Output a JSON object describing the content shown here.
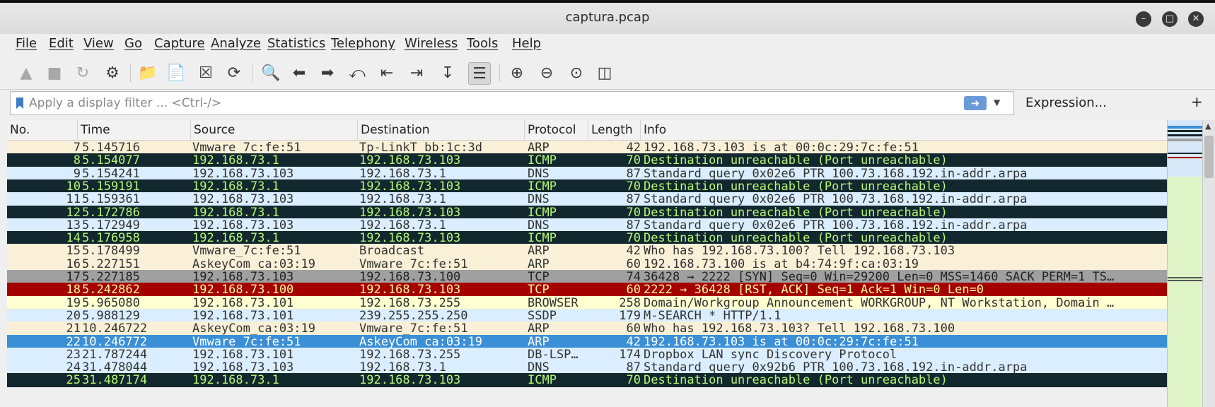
{
  "window": {
    "title": "captura.pcap"
  },
  "menu": [
    "File",
    "Edit",
    "View",
    "Go",
    "Capture",
    "Analyze",
    "Statistics",
    "Telephony",
    "Wireless",
    "Tools",
    "Help"
  ],
  "filter": {
    "placeholder": "Apply a display filter ... <Ctrl-/>",
    "expression_label": "Expression...",
    "add_label": "+"
  },
  "columns": [
    "No.",
    "Time",
    "Source",
    "Destination",
    "Protocol",
    "Length",
    "Info"
  ],
  "colors": {
    "arp_bg": "#faf0d7",
    "icmp_bg": "#12272e",
    "icmp_fg": "#b7f774",
    "dns_bg": "#daeeff",
    "tcp_syn_bg": "#a0a0a0",
    "tcp_rst_bg": "#a40000",
    "tcp_rst_fg": "#fffc9c",
    "browser_bg": "#fefed0",
    "selected_bg": "#3b8fd6"
  },
  "packets": [
    {
      "no": "7",
      "time": "5.145716",
      "src": "Vmware_7c:fe:51",
      "dst": "Tp-LinkT_bb:1c:3d",
      "proto": "ARP",
      "len": "42",
      "info": "192.168.73.103 is at 00:0c:29:7c:fe:51",
      "style": "arp"
    },
    {
      "no": "8",
      "time": "5.154077",
      "src": "192.168.73.1",
      "dst": "192.168.73.103",
      "proto": "ICMP",
      "len": "70",
      "info": "Destination unreachable (Port unreachable)",
      "style": "icmp"
    },
    {
      "no": "9",
      "time": "5.154241",
      "src": "192.168.73.103",
      "dst": "192.168.73.1",
      "proto": "DNS",
      "len": "87",
      "info": "Standard query 0x02e6 PTR 100.73.168.192.in-addr.arpa",
      "style": "dns"
    },
    {
      "no": "10",
      "time": "5.159191",
      "src": "192.168.73.1",
      "dst": "192.168.73.103",
      "proto": "ICMP",
      "len": "70",
      "info": "Destination unreachable (Port unreachable)",
      "style": "icmp"
    },
    {
      "no": "11",
      "time": "5.159361",
      "src": "192.168.73.103",
      "dst": "192.168.73.1",
      "proto": "DNS",
      "len": "87",
      "info": "Standard query 0x02e6 PTR 100.73.168.192.in-addr.arpa",
      "style": "dns"
    },
    {
      "no": "12",
      "time": "5.172786",
      "src": "192.168.73.1",
      "dst": "192.168.73.103",
      "proto": "ICMP",
      "len": "70",
      "info": "Destination unreachable (Port unreachable)",
      "style": "icmp"
    },
    {
      "no": "13",
      "time": "5.172949",
      "src": "192.168.73.103",
      "dst": "192.168.73.1",
      "proto": "DNS",
      "len": "87",
      "info": "Standard query 0x02e6 PTR 100.73.168.192.in-addr.arpa",
      "style": "dns"
    },
    {
      "no": "14",
      "time": "5.176958",
      "src": "192.168.73.1",
      "dst": "192.168.73.103",
      "proto": "ICMP",
      "len": "70",
      "info": "Destination unreachable (Port unreachable)",
      "style": "icmp"
    },
    {
      "no": "15",
      "time": "5.178499",
      "src": "Vmware_7c:fe:51",
      "dst": "Broadcast",
      "proto": "ARP",
      "len": "42",
      "info": "Who has 192.168.73.100? Tell 192.168.73.103",
      "style": "arp"
    },
    {
      "no": "16",
      "time": "5.227151",
      "src": "AskeyCom_ca:03:19",
      "dst": "Vmware_7c:fe:51",
      "proto": "ARP",
      "len": "60",
      "info": "192.168.73.100 is at b4:74:9f:ca:03:19",
      "style": "arp"
    },
    {
      "no": "17",
      "time": "5.227185",
      "src": "192.168.73.103",
      "dst": "192.168.73.100",
      "proto": "TCP",
      "len": "74",
      "info": "36428 → 2222 [SYN] Seq=0 Win=29200 Len=0 MSS=1460 SACK_PERM=1 TS…",
      "style": "tcpsyn"
    },
    {
      "no": "18",
      "time": "5.242862",
      "src": "192.168.73.100",
      "dst": "192.168.73.103",
      "proto": "TCP",
      "len": "60",
      "info": "2222 → 36428 [RST, ACK] Seq=1 Ack=1 Win=0 Len=0",
      "style": "tcprst"
    },
    {
      "no": "19",
      "time": "5.965080",
      "src": "192.168.73.101",
      "dst": "192.168.73.255",
      "proto": "BROWSER",
      "len": "258",
      "info": "Domain/Workgroup Announcement WORKGROUP, NT Workstation, Domain …",
      "style": "browser"
    },
    {
      "no": "20",
      "time": "5.988129",
      "src": "192.168.73.101",
      "dst": "239.255.255.250",
      "proto": "SSDP",
      "len": "179",
      "info": "M-SEARCH * HTTP/1.1",
      "style": "dns"
    },
    {
      "no": "21",
      "time": "10.246722",
      "src": "AskeyCom_ca:03:19",
      "dst": "Vmware_7c:fe:51",
      "proto": "ARP",
      "len": "60",
      "info": "Who has 192.168.73.103? Tell 192.168.73.100",
      "style": "arp"
    },
    {
      "no": "22",
      "time": "10.246772",
      "src": "Vmware_7c:fe:51",
      "dst": "AskeyCom_ca:03:19",
      "proto": "ARP",
      "len": "42",
      "info": "192.168.73.103 is at 00:0c:29:7c:fe:51",
      "style": "selected"
    },
    {
      "no": "23",
      "time": "21.787244",
      "src": "192.168.73.101",
      "dst": "192.168.73.255",
      "proto": "DB-LSP…",
      "len": "174",
      "info": "Dropbox LAN sync Discovery Protocol",
      "style": "dns"
    },
    {
      "no": "24",
      "time": "31.478044",
      "src": "192.168.73.103",
      "dst": "192.168.73.1",
      "proto": "DNS",
      "len": "87",
      "info": "Standard query 0x92b6 PTR 100.73.168.192.in-addr.arpa",
      "style": "dns"
    },
    {
      "no": "25",
      "time": "31.487174",
      "src": "192.168.73.1",
      "dst": "192.168.73.103",
      "proto": "ICMP",
      "len": "70",
      "info": "Destination unreachable (Port unreachable)",
      "style": "icmp"
    }
  ]
}
